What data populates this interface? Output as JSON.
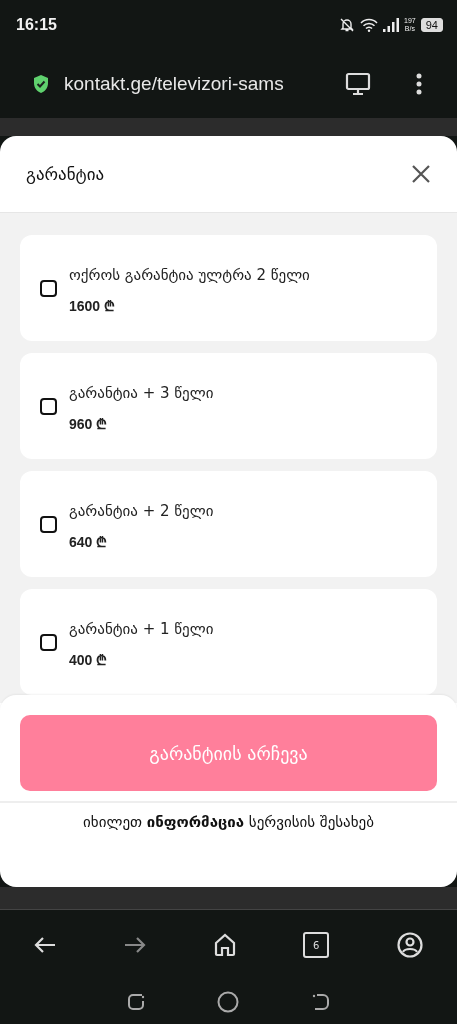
{
  "status_bar": {
    "time": "16:15",
    "speed_value": "197",
    "speed_unit": "B/s",
    "battery": "94"
  },
  "browser": {
    "url": "kontakt.ge/televizori-sams"
  },
  "modal": {
    "title": "გარანტია",
    "options": [
      {
        "name": "ოქროს გარანტია ულტრა 2 წელი",
        "price": "1600 ₾",
        "checked": false
      },
      {
        "name": "გარანტია + 3 წელი",
        "price": "960 ₾",
        "checked": false
      },
      {
        "name": "გარანტია + 2 წელი",
        "price": "640 ₾",
        "checked": false
      },
      {
        "name": "გარანტია + 1 წელი",
        "price": "400 ₾",
        "checked": false
      }
    ],
    "button": "გარანტიის არჩევა",
    "info": "იხილეთ **ინფორმაცია** სერვისის შესახებ"
  },
  "bottom_nav": {
    "tabs_count": "6"
  }
}
